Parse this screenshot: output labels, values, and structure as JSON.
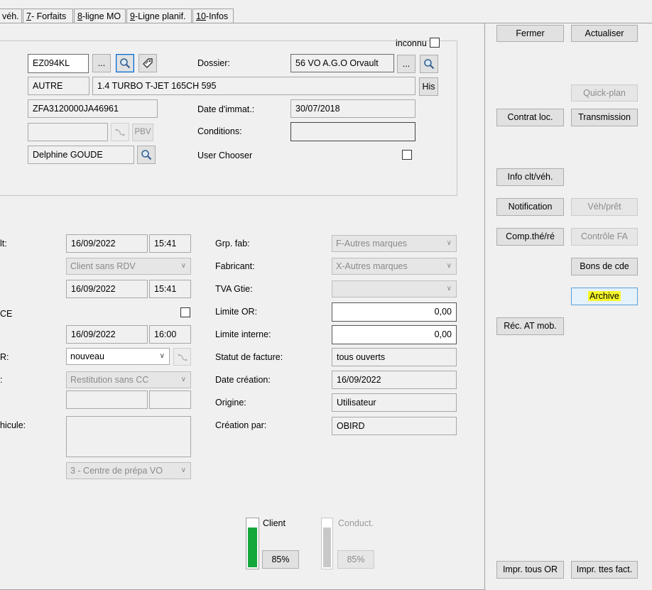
{
  "tabs": [
    {
      "label": "véh."
    },
    {
      "label_prefix": "",
      "label_key": "7",
      "label_rest": "- Forfaits"
    },
    {
      "label_prefix": "",
      "label_key": "8",
      "label_rest": "-ligne MO"
    },
    {
      "label_prefix": "",
      "label_key": "9",
      "label_rest": "-Ligne planif."
    },
    {
      "label_prefix": "",
      "label_key": "10",
      "label_rest": "-Infos"
    }
  ],
  "vehicle": {
    "inconnu_label": "inconnu",
    "immat": "EZ094KL",
    "dots_label": "...",
    "dossier_label": "Dossier:",
    "dossier_value": "56 VO A.G.O Orvault",
    "marque": "AUTRE",
    "modele": "1.4 TURBO T-JET 165CH 595",
    "his_label": "His",
    "vin": "ZFA3120000JA46961",
    "date_immat_label": "Date d'immat.:",
    "date_immat_value": "30/07/2018",
    "pbv_label": "PBV",
    "conditions_label": "Conditions:",
    "conditions_value": "",
    "contact": "Delphine GOUDE",
    "user_chooser_label": "User Chooser"
  },
  "left_fields": {
    "row1_label": "lt:",
    "row1_date": "16/09/2022",
    "row1_time": "15:41",
    "row2_select": "Client sans RDV",
    "row3_date": "16/09/2022",
    "row3_time": "15:41",
    "row4_label": "CE",
    "row5_date": "16/09/2022",
    "row5_time": "16:00",
    "row6_label": "R:",
    "row6_select": "nouveau",
    "row7_label": ":",
    "row7_select": "Restitution sans CC",
    "row9_label": "hicule:",
    "row10_select": "3 - Centre de prépa VO"
  },
  "right_fields": {
    "grp_fab_label": "Grp. fab:",
    "grp_fab_value": "F-Autres marques",
    "fabricant_label": "Fabricant:",
    "fabricant_value": "X-Autres marques",
    "tva_label": "TVA Gtie:",
    "tva_value": "",
    "limite_or_label": "Limite OR:",
    "limite_or_value": "0,00",
    "limite_interne_label": "Limite interne:",
    "limite_interne_value": "0,00",
    "statut_label": "Statut de facture:",
    "statut_value": "tous ouverts",
    "date_creation_label": "Date création:",
    "date_creation_value": "16/09/2022",
    "origine_label": "Origine:",
    "origine_value": "Utilisateur",
    "creation_par_label": "Création par:",
    "creation_par_value": "OBIRD"
  },
  "gauges": {
    "client_label": "Client",
    "client_pct_label": "85%",
    "client_level": 0.85,
    "client_color": "#14a83b",
    "conduct_label": "Conduct.",
    "conduct_pct_label": "85%",
    "conduct_level": 0.85,
    "conduct_color": "#c8c8c8"
  },
  "actions": {
    "fermer": "Fermer",
    "actualiser": "Actualiser",
    "quick_plan": "Quick-plan",
    "contrat_loc": "Contrat loc.",
    "transmission": "Transmission",
    "info_clt": "Info clt/véh.",
    "notification": "Notification",
    "veh_pret": "Véh/prêt",
    "comp_the": "Comp.thé/ré",
    "controle_fa": "Contrôle FA",
    "bons_cde": "Bons de cde",
    "archive": "Archive",
    "rec_at": "Réc. AT mob.",
    "impr_tous_or": "Impr. tous OR",
    "impr_ttes_fact": "Impr. ttes fact."
  },
  "colors": {
    "highlight": "#f7f72a",
    "focus_border": "#0a64c8"
  }
}
